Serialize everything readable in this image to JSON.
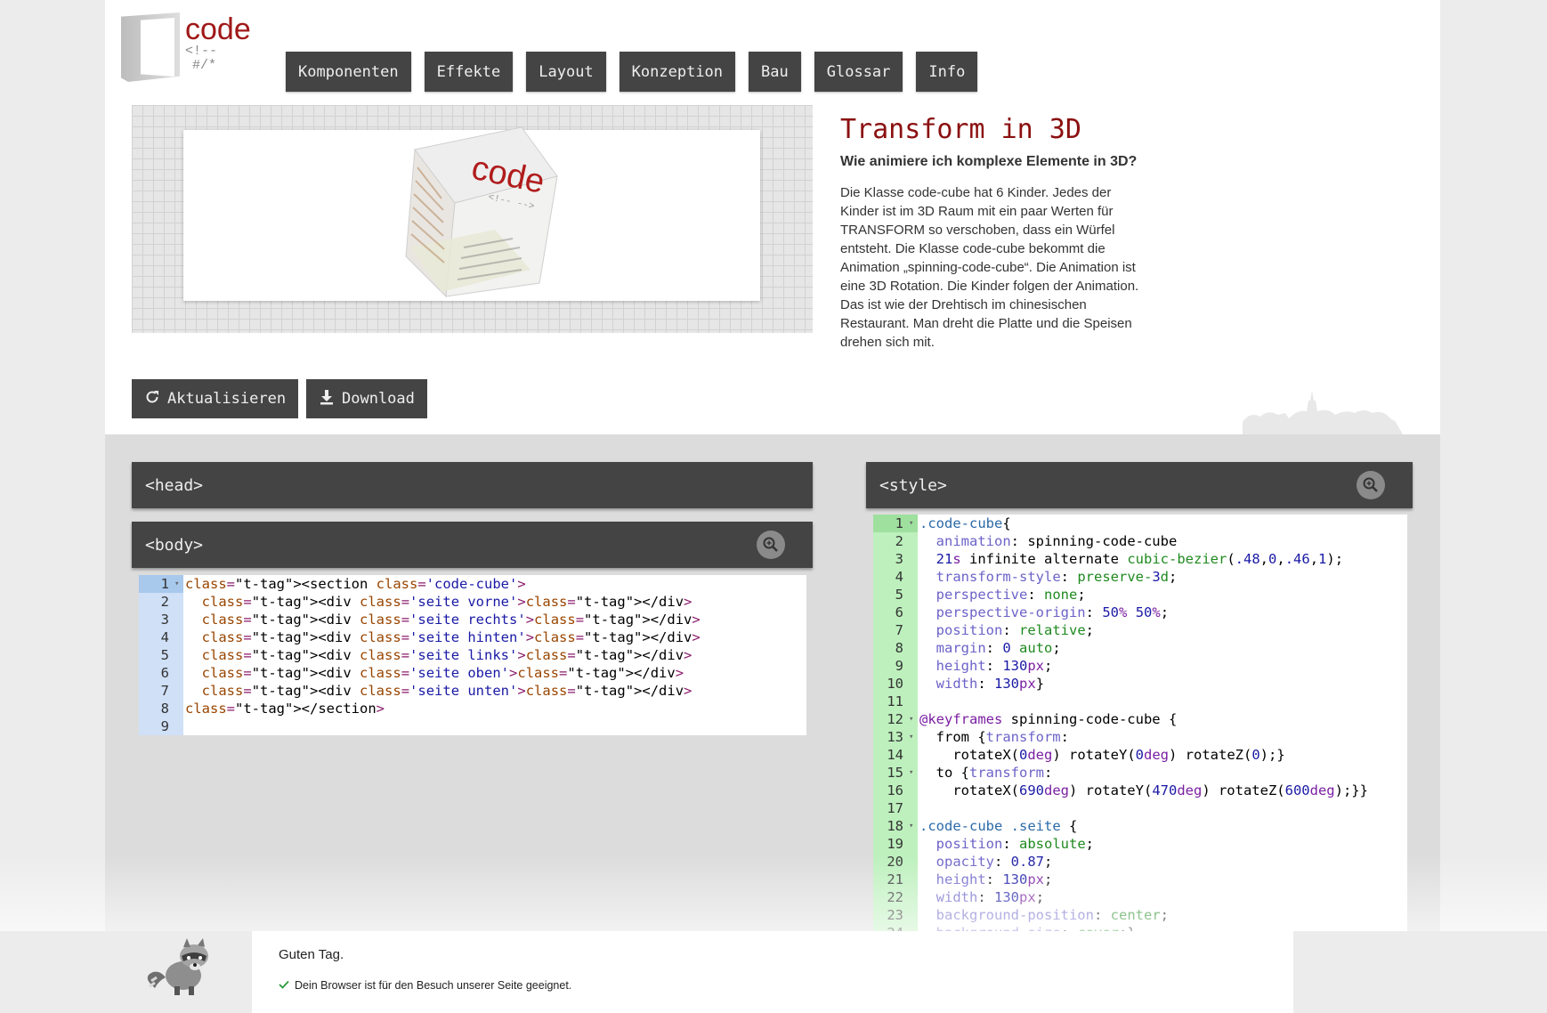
{
  "logo": {
    "word": "code",
    "comment1": "<!--",
    "comment2": "#/*"
  },
  "nav": [
    "Komponenten",
    "Effekte",
    "Layout",
    "Konzeption",
    "Bau",
    "Glossar",
    "Info"
  ],
  "preview": {
    "cube_label": "code"
  },
  "article": {
    "title": "Transform in 3D",
    "subtitle": "Wie animiere ich komplexe Elemente in 3D?",
    "description": "Die Klasse code-cube hat 6 Kinder. Jedes der Kinder ist im 3D Raum mit ein paar Werten für TRANSFORM so verschoben, dass ein Würfel entsteht. Die Klasse code-cube bekommt die Animation „spinning-code-cube“. Die Animation ist eine 3D Rotation. Die Kinder folgen der Animation. Das ist wie der Drehtisch im chinesischen Restaurant. Man dreht die Platte und die Speisen drehen sich mit."
  },
  "actions": {
    "refresh": "Aktualisieren",
    "download": "Download"
  },
  "panels": {
    "head": "<head>",
    "body": "<body>",
    "style": "<style>"
  },
  "html_code": [
    "<section class='code-cube'>",
    "  <div class='seite vorne'></div>",
    "  <div class='seite rechts'></div>",
    "  <div class='seite hinten'></div>",
    "  <div class='seite links'></div>",
    "  <div class='seite oben'></div>",
    "  <div class='seite unten'></div>",
    "</section>",
    ""
  ],
  "css_code": [
    ".code-cube{",
    "  animation: spinning-code-cube",
    "  21s infinite alternate cubic-bezier(.48,0,.46,1);",
    "  transform-style: preserve-3d;",
    "  perspective: none;",
    "  perspective-origin: 50% 50%;",
    "  position: relative;",
    "  margin: 0 auto;",
    "  height: 130px;",
    "  width: 130px}",
    "",
    "@keyframes spinning-code-cube {",
    "  from {transform:",
    "    rotateX(0deg) rotateY(0deg) rotateZ(0);}",
    "  to {transform:",
    "    rotateX(690deg) rotateY(470deg) rotateZ(600deg);}}",
    "",
    ".code-cube .seite {",
    "  position: absolute;",
    "  opacity: 0.87;",
    "  height: 130px;",
    "  width: 130px;",
    "  background-position: center;",
    "  background-size: cover;}"
  ],
  "notice": {
    "title": "Guten Tag.",
    "message": "Dein Browser ist für den Besuch unserer Seite geeignet."
  }
}
